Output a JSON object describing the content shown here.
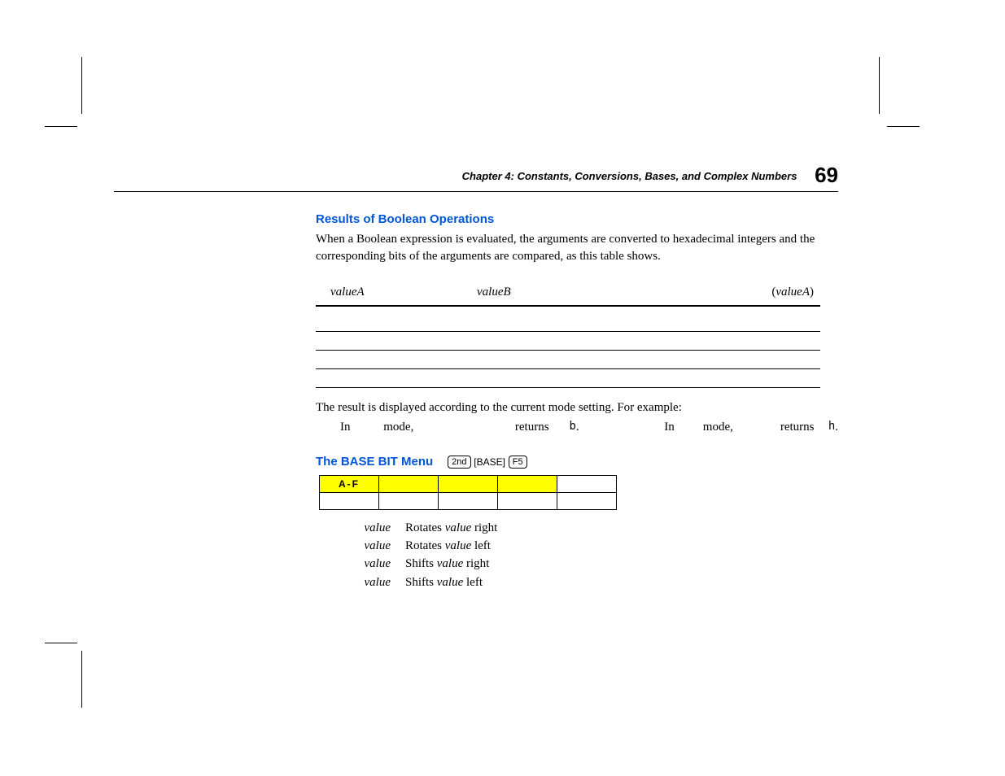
{
  "header": {
    "chapter_line": "Chapter 4:  Constants, Conversions, Bases, and Complex Numbers",
    "page_number": "69"
  },
  "section1": {
    "title": "Results of Boolean Operations",
    "body": "When a Boolean expression is evaluated, the arguments are converted to hexadecimal integers and the corresponding bits of the arguments are compared, as this table shows."
  },
  "bool_table_header": {
    "colA": "valueA",
    "colB": "valueB",
    "result_prefix": "(",
    "result_mid": "valueA",
    "result_suffix": ")"
  },
  "mode_sentence": "The result is displayed according to the current mode setting. For example:",
  "mode_examples": {
    "left": {
      "w1": "In",
      "w2": "mode,",
      "w3": "returns",
      "w4": "b",
      "w5": "."
    },
    "right": {
      "w1": "In",
      "w2": "mode,",
      "w3": "returns",
      "w4": "h",
      "w5": "."
    }
  },
  "section2": {
    "title": "The BASE BIT Menu",
    "keys": [
      "2nd",
      "BASE",
      "F5"
    ]
  },
  "menu_table": {
    "highlight_cell": "A‑F",
    "row1": [
      "",
      "",
      "",
      "",
      ""
    ],
    "row2": [
      "",
      "",
      "",
      "",
      ""
    ]
  },
  "defs": [
    {
      "term": "value",
      "desc_pre": "Rotates ",
      "desc_it": "value",
      "desc_post": " right"
    },
    {
      "term": "value",
      "desc_pre": "Rotates ",
      "desc_it": "value",
      "desc_post": " left"
    },
    {
      "term": "value",
      "desc_pre": "Shifts ",
      "desc_it": "value",
      "desc_post": " right"
    },
    {
      "term": "value",
      "desc_pre": "Shifts ",
      "desc_it": "value",
      "desc_post": " left"
    }
  ]
}
